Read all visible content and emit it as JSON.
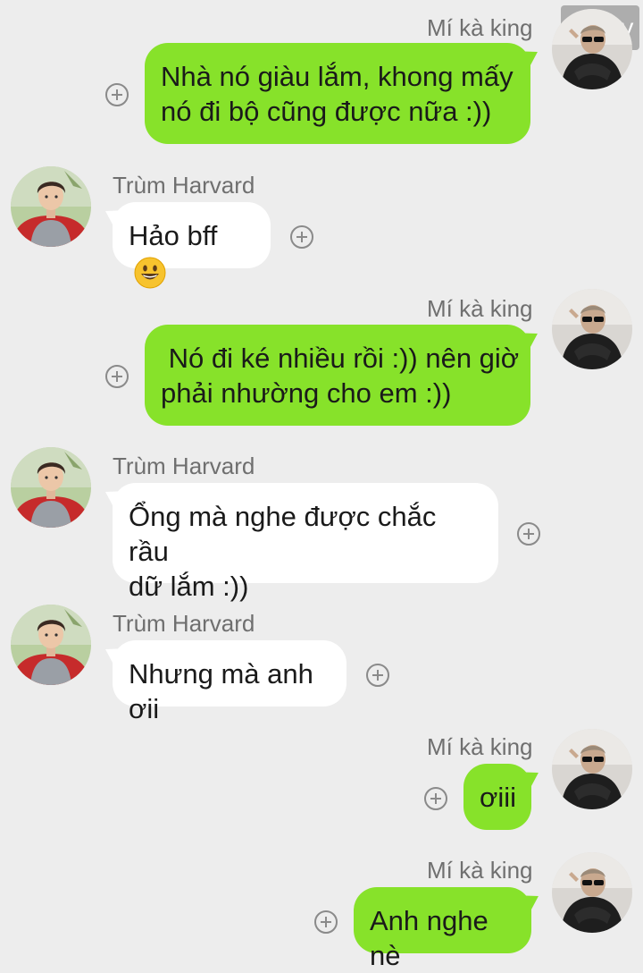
{
  "watermark": "70 joy",
  "messages": [
    {
      "sender": "Mí kà king",
      "lines": [
        "Nhà nó giàu lắm, khong mấy",
        "nó đi bộ cũng được nữa :))"
      ],
      "direction": "outgoing",
      "avatar": "sunglasses-man-avatar"
    },
    {
      "sender": "Trùm Harvard",
      "lines": [
        "Hảo bff"
      ],
      "emoji": "grinning-face-icon",
      "direction": "incoming",
      "avatar": "young-man-red-shirt-avatar"
    },
    {
      "sender": "Mí kà king",
      "lines": [
        " Nó đi ké nhiều rồi :)) nên giờ",
        "phải nhường cho em :))"
      ],
      "direction": "outgoing",
      "avatar": "sunglasses-man-avatar"
    },
    {
      "sender": "Trùm Harvard",
      "lines": [
        "Ổng mà nghe được chắc rầu",
        "dữ lắm :))"
      ],
      "direction": "incoming",
      "avatar": "young-man-red-shirt-avatar"
    },
    {
      "sender": "Trùm Harvard",
      "lines": [
        "Nhưng mà anh ơii"
      ],
      "direction": "incoming",
      "avatar": "young-man-red-shirt-avatar"
    },
    {
      "sender": "Mí kà king",
      "lines": [
        "ơiii"
      ],
      "direction": "outgoing",
      "avatar": "sunglasses-man-avatar"
    },
    {
      "sender": "Mí kà king",
      "lines": [
        "Anh nghe nè"
      ],
      "direction": "outgoing",
      "avatar": "sunglasses-man-avatar"
    }
  ],
  "colors": {
    "outgoing_bubble": "#87e22a",
    "incoming_bubble": "#ffffff",
    "background": "#ededed"
  }
}
